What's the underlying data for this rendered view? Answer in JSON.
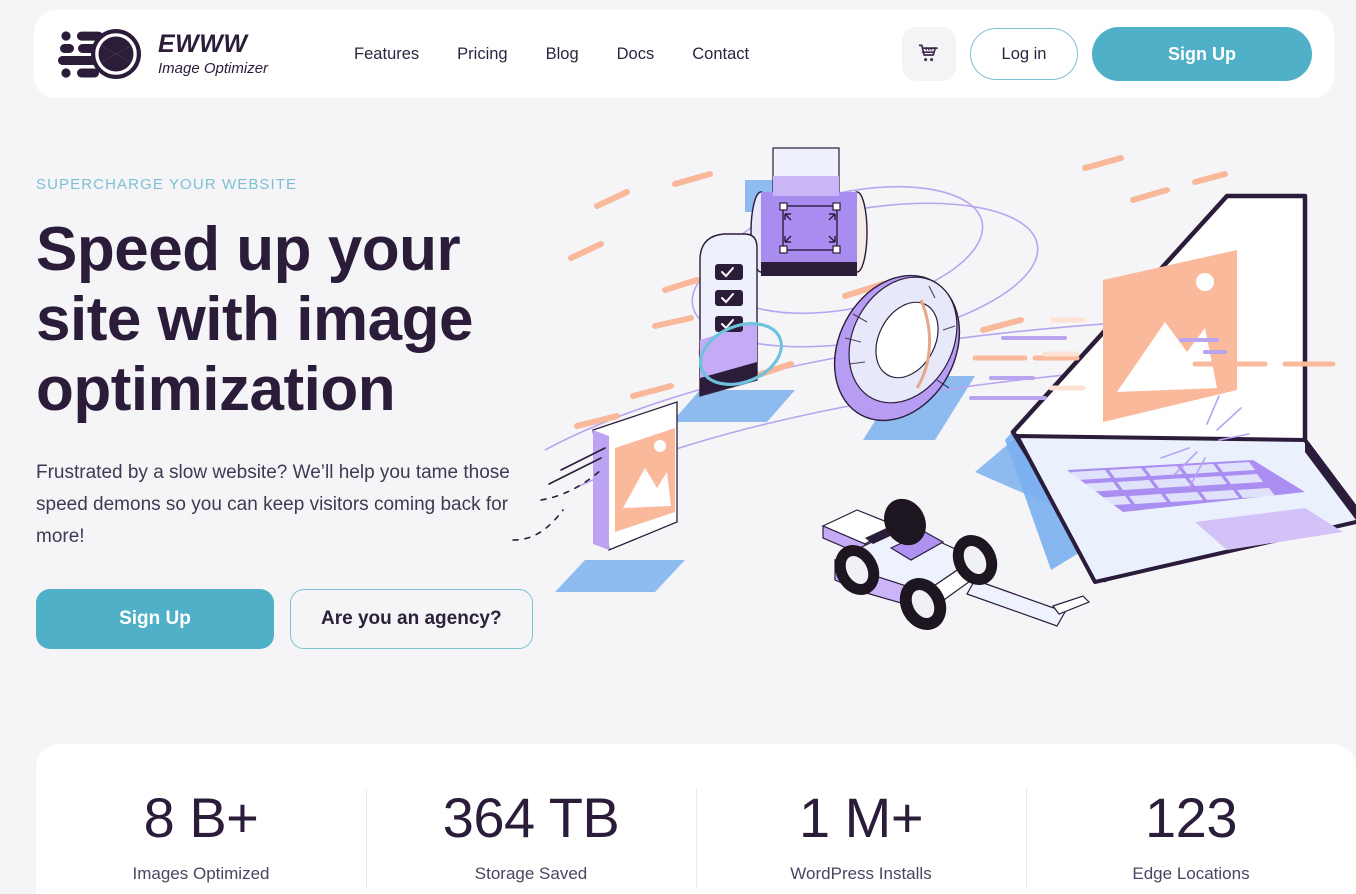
{
  "brand": {
    "name": "EWWW",
    "tagline": "Image Optimizer",
    "logo_icon": "camera-aperture-speed-lines-icon",
    "accent_color": "#4fb0c8",
    "dark_color": "#2b1c3a",
    "page_background": "#f5f5f8"
  },
  "header": {
    "nav_items": [
      {
        "label": "Features"
      },
      {
        "label": "Pricing"
      },
      {
        "label": "Blog"
      },
      {
        "label": "Docs"
      },
      {
        "label": "Contact"
      }
    ],
    "cart_icon": "shopping-cart-icon",
    "login_label": "Log in",
    "signup_label": "Sign Up"
  },
  "hero": {
    "eyebrow": "SUPERCHARGE YOUR WEBSITE",
    "title": "Speed up your site with image optimization",
    "subtitle": "Frustrated by a slow website? We’ll help you tame those speed demons so you can keep visitors coming back for more!",
    "primary_cta": "Sign Up",
    "secondary_cta": "Are you an agency?",
    "illustration": "isometric-laptop-camera-race-car-image-optimization-illustration"
  },
  "stats": [
    {
      "value": "8 B+",
      "label": "Images Optimized"
    },
    {
      "value": "364 TB",
      "label": "Storage Saved"
    },
    {
      "value": "1 M+",
      "label": "WordPress Installs"
    },
    {
      "value": "123",
      "label": "Edge Locations"
    }
  ]
}
